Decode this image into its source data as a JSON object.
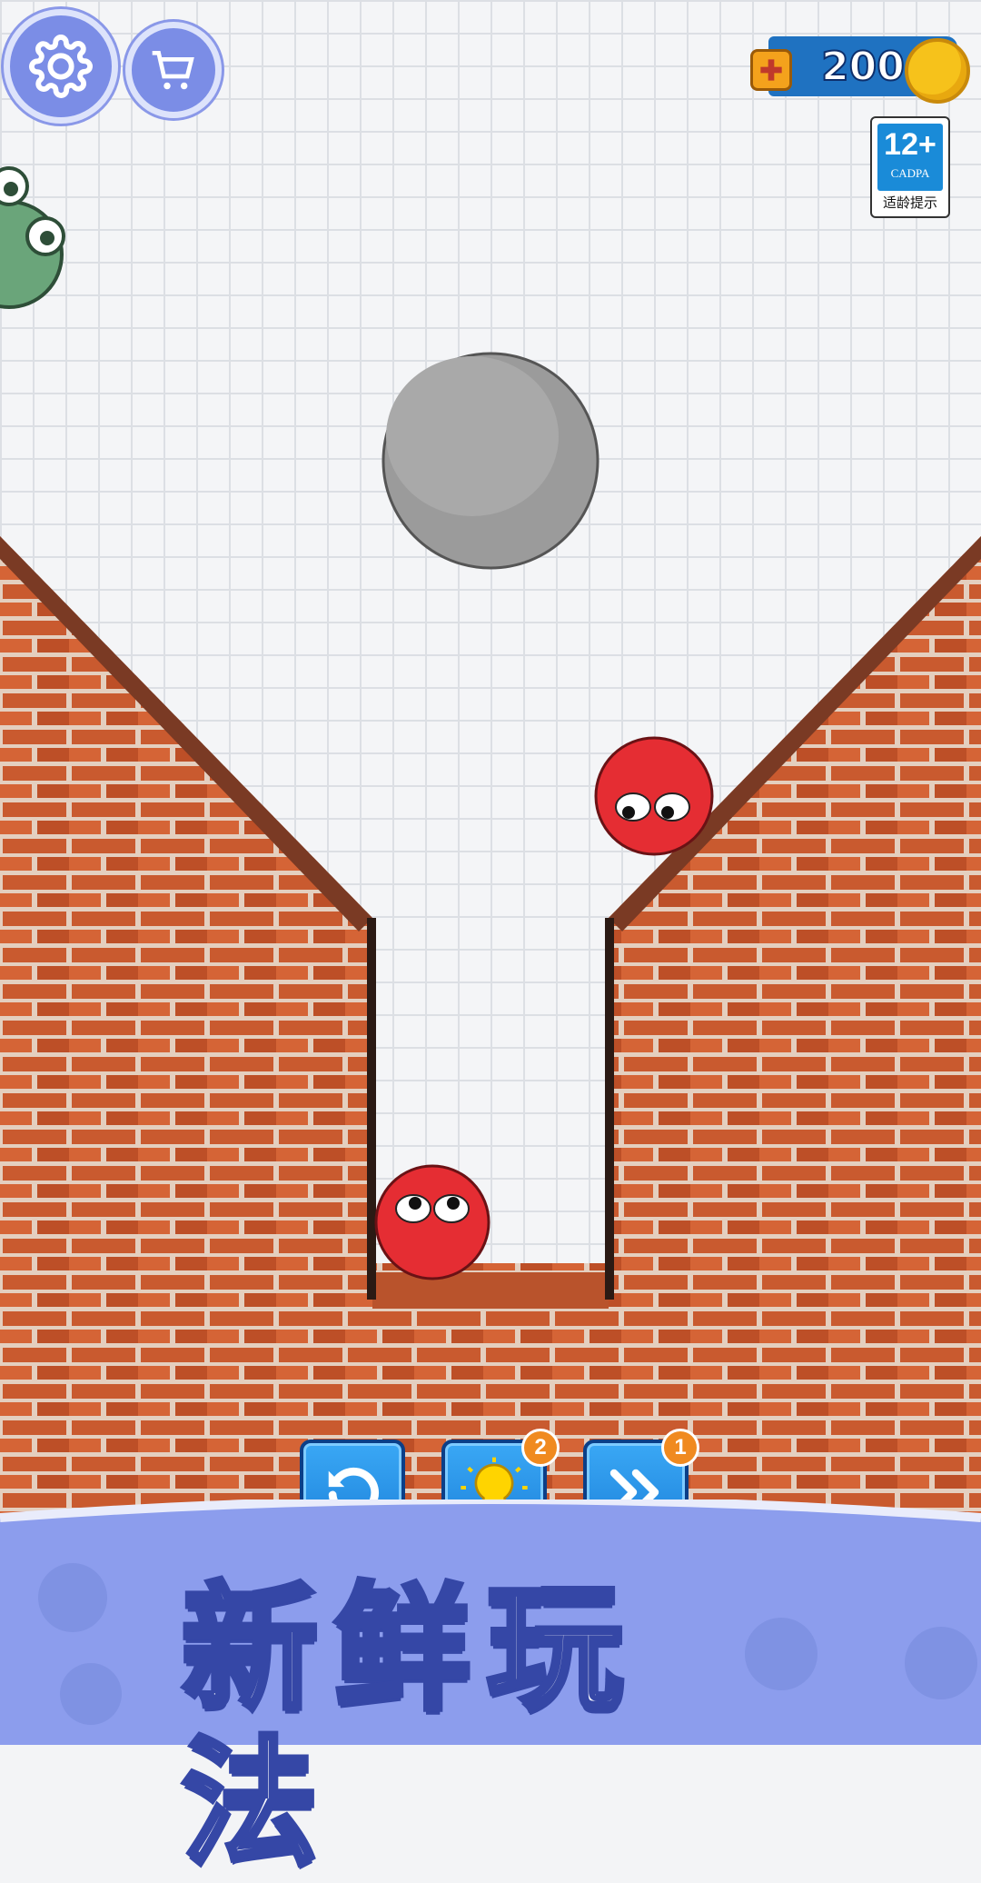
{
  "hud": {
    "coins": "200",
    "age_rating": {
      "number": "12+",
      "org": "CADPA",
      "caption": "适龄提示"
    },
    "settings_icon": "gear-icon",
    "shop_icon": "shopping-cart-icon",
    "add_coins_icon": "plus-icon"
  },
  "level": {
    "stone_ball_color": "#9a9a9a",
    "red_ball_color": "#e52d33",
    "brick_color": "#c8582e"
  },
  "controls": {
    "restart_icon": "restart-icon",
    "hint_icon": "lightbulb-icon",
    "hint_count": "2",
    "skip_icon": "fast-forward-icon",
    "skip_count": "1"
  },
  "banner": {
    "title": "新鲜玩法",
    "color": "#8c9ded"
  }
}
